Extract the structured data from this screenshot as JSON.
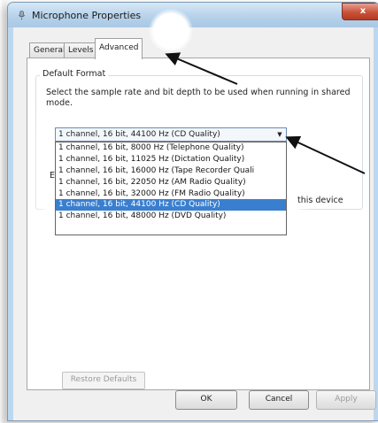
{
  "window": {
    "title": "Microphone Properties",
    "close_glyph": "x"
  },
  "tabs": [
    {
      "label": "General",
      "active": false
    },
    {
      "label": "Levels",
      "active": false
    },
    {
      "label": "Advanced",
      "active": true
    }
  ],
  "default_format": {
    "group_title": "Default Format",
    "description": "Select the sample rate and bit depth to be used when running in shared mode.",
    "selected_value": "1 channel, 16 bit, 44100 Hz (CD Quality)",
    "options": [
      "1 channel, 16 bit, 8000 Hz (Telephone Quality)",
      "1 channel, 16 bit, 11025 Hz (Dictation Quality)",
      "1 channel, 16 bit, 16000 Hz (Tape Recorder Quali",
      "1 channel, 16 bit, 22050 Hz (AM Radio Quality)",
      "1 channel, 16 bit, 32000 Hz (FM Radio Quality)",
      "1 channel, 16 bit, 44100 Hz (CD Quality)",
      "1 channel, 16 bit, 48000 Hz (DVD Quality)"
    ],
    "highlighted_index": 5
  },
  "partial_text": {
    "left_fragment": "E",
    "right_fragment": "this device"
  },
  "buttons": {
    "restore_defaults": "Restore Defaults",
    "ok": "OK",
    "cancel": "Cancel",
    "apply": "Apply"
  }
}
